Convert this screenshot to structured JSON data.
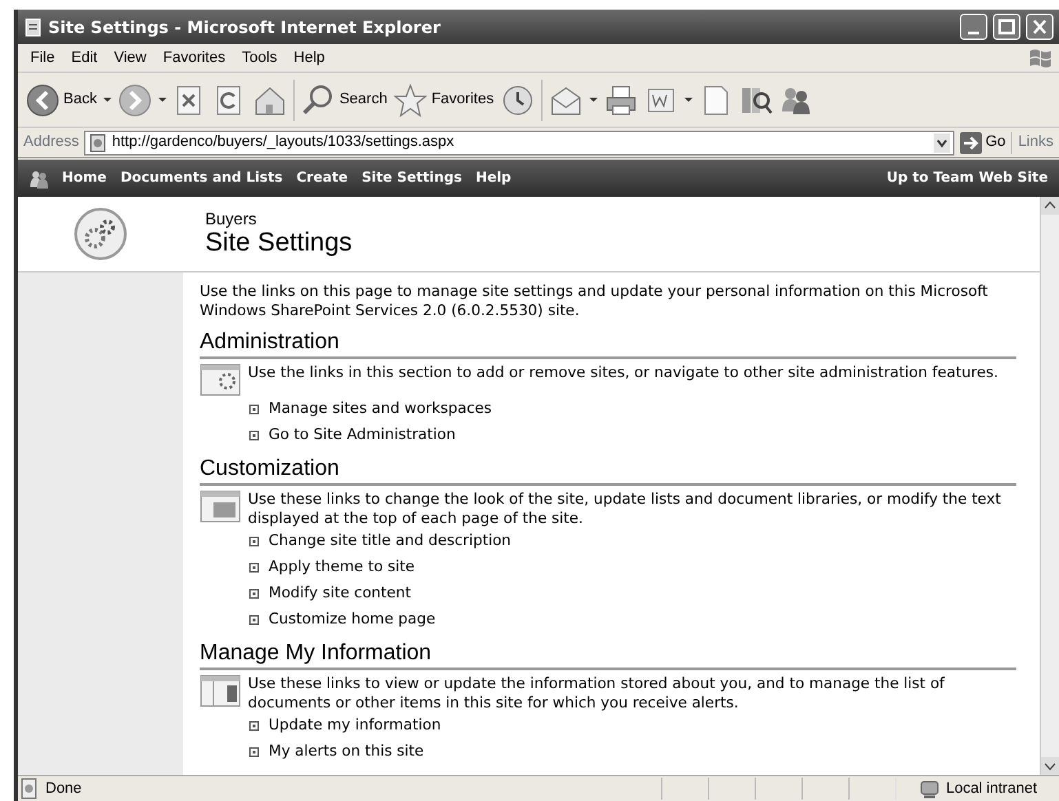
{
  "window": {
    "title": "Site Settings - Microsoft Internet Explorer"
  },
  "menu": [
    "File",
    "Edit",
    "View",
    "Favorites",
    "Tools",
    "Help"
  ],
  "toolbar": [
    {
      "kind": "back",
      "label": "Back"
    },
    {
      "kind": "forward"
    },
    {
      "kind": "stop"
    },
    {
      "kind": "refresh"
    },
    {
      "kind": "home"
    },
    {
      "kind": "sep"
    },
    {
      "kind": "search",
      "label": "Search"
    },
    {
      "kind": "favorites",
      "label": "Favorites"
    },
    {
      "kind": "history"
    },
    {
      "kind": "sep"
    },
    {
      "kind": "mail"
    },
    {
      "kind": "print"
    },
    {
      "kind": "word"
    },
    {
      "kind": "doc"
    },
    {
      "kind": "research"
    },
    {
      "kind": "messenger"
    }
  ],
  "address": {
    "label": "Address",
    "url": "http://gardenco/buyers/_layouts/1033/settings.aspx",
    "go": "Go",
    "links": "Links"
  },
  "nav": {
    "items": [
      "Home",
      "Documents and Lists",
      "Create",
      "Site Settings",
      "Help"
    ],
    "right": "Up to Team Web Site"
  },
  "header": {
    "site": "Buyers",
    "title": "Site Settings"
  },
  "intro": "Use the links on this page to manage site settings and update your personal information on this Microsoft Windows SharePoint Services 2.0 (6.0.2.5530) site.",
  "sections": [
    {
      "kind": "admin",
      "heading": "Administration",
      "description": "Use the links in this section to add or remove sites, or navigate to other site administration features.",
      "links": [
        "Manage sites and workspaces",
        "Go to Site Administration"
      ]
    },
    {
      "kind": "custom",
      "heading": "Customization",
      "description": "Use these links to change the look of the site, update lists and document libraries, or modify the text displayed at the top of each page of the site.",
      "links": [
        "Change site title and description",
        "Apply theme to site",
        "Modify site content",
        "Customize home page"
      ]
    },
    {
      "kind": "info",
      "heading": "Manage My Information",
      "description": "Use these links to view or update the information stored about you, and to manage the list of documents or other items in this site for which you receive alerts.",
      "links": [
        "Update my information",
        "My alerts on this site"
      ]
    }
  ],
  "status_bar": {
    "text": "Done",
    "zone": "Local intranet"
  }
}
